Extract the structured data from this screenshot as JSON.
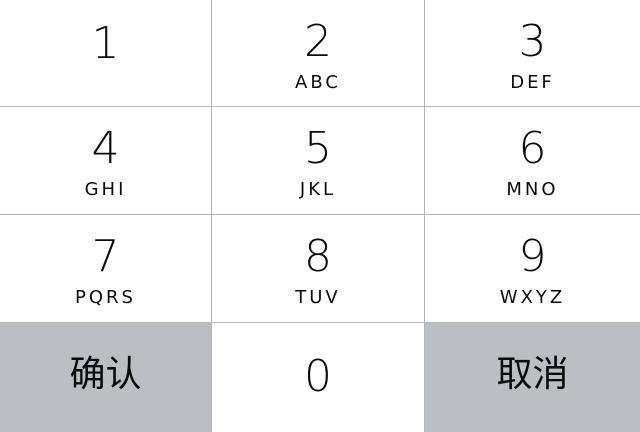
{
  "keys": [
    {
      "digit": "1",
      "letters": ""
    },
    {
      "digit": "2",
      "letters": "ABC"
    },
    {
      "digit": "3",
      "letters": "DEF"
    },
    {
      "digit": "4",
      "letters": "GHI"
    },
    {
      "digit": "5",
      "letters": "JKL"
    },
    {
      "digit": "6",
      "letters": "MNO"
    },
    {
      "digit": "7",
      "letters": "PQRS"
    },
    {
      "digit": "8",
      "letters": "TUV"
    },
    {
      "digit": "9",
      "letters": "WXYZ"
    },
    {
      "digit": "0",
      "letters": ""
    }
  ],
  "confirm_label": "确认",
  "cancel_label": "取消",
  "colors": {
    "key_background": "#ffffff",
    "action_key_background": "#bbbec3",
    "divider": "#b3b5b8",
    "text": "#0b0b0b"
  }
}
